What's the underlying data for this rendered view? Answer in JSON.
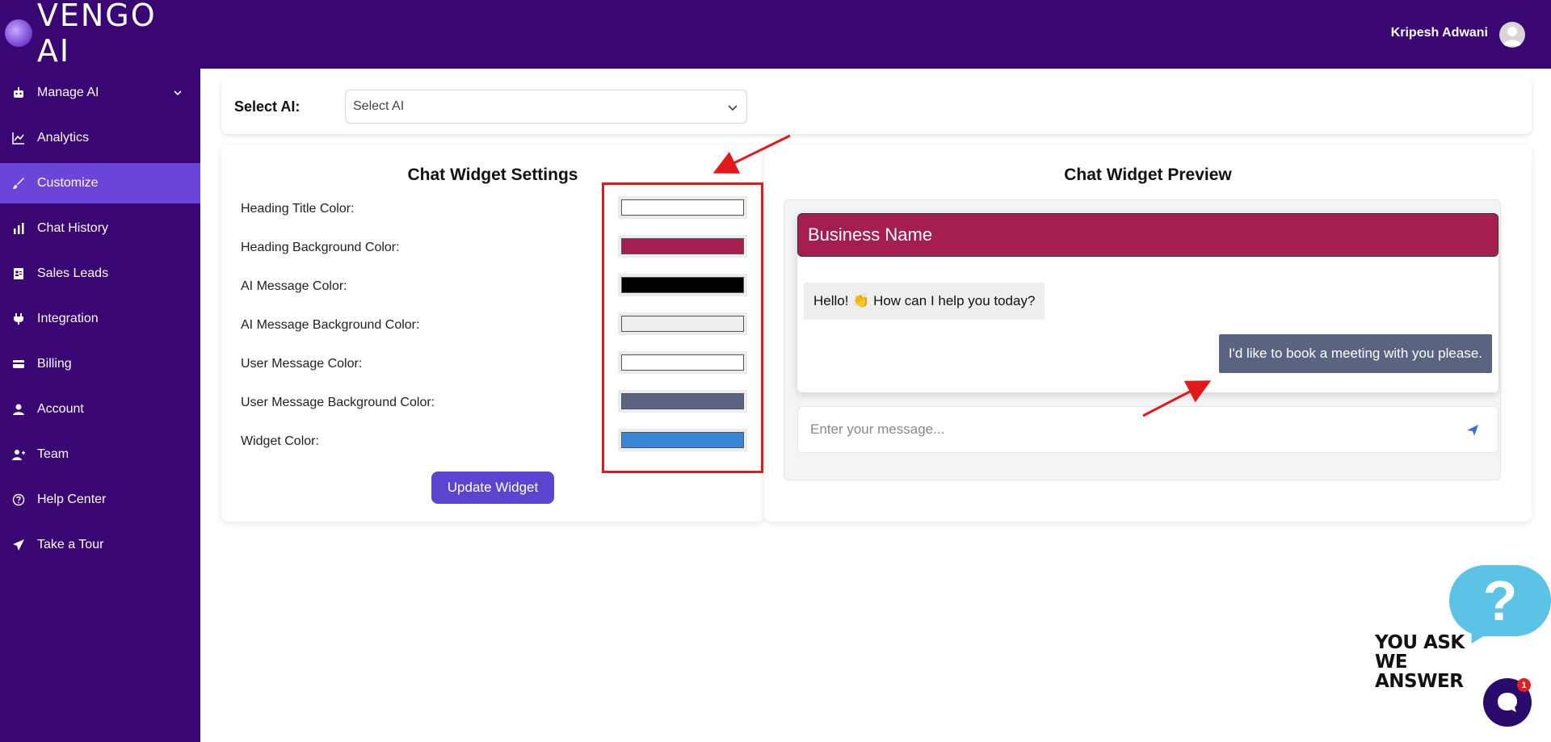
{
  "brand": {
    "name": "VENGO AI"
  },
  "user": {
    "name": "Kripesh Adwani"
  },
  "sidebar": {
    "items": [
      {
        "label": "Manage AI",
        "icon": "robot-icon",
        "active": false,
        "has_dropdown": true
      },
      {
        "label": "Analytics",
        "icon": "chart-line-icon",
        "active": false
      },
      {
        "label": "Customize",
        "icon": "brush-icon",
        "active": true
      },
      {
        "label": "Chat History",
        "icon": "bar-chart-icon",
        "active": false
      },
      {
        "label": "Sales Leads",
        "icon": "contact-card-icon",
        "active": false
      },
      {
        "label": "Integration",
        "icon": "plug-icon",
        "active": false
      },
      {
        "label": "Billing",
        "icon": "credit-card-icon",
        "active": false
      },
      {
        "label": "Account",
        "icon": "user-icon",
        "active": false
      },
      {
        "label": "Team",
        "icon": "user-plus-icon",
        "active": false
      },
      {
        "label": "Help Center",
        "icon": "question-circle-icon",
        "active": false
      },
      {
        "label": "Take a Tour",
        "icon": "paper-plane-icon",
        "active": false
      }
    ]
  },
  "select_ai": {
    "label": "Select AI:",
    "placeholder": "Select AI"
  },
  "settings": {
    "title": "Chat Widget Settings",
    "rows": [
      {
        "label": "Heading Title Color:",
        "color": "#ffffff"
      },
      {
        "label": "Heading Background Color:",
        "color": "#a51e52"
      },
      {
        "label": "AI Message Color:",
        "color": "#000000"
      },
      {
        "label": "AI Message Background Color:",
        "color": "#eeeeee"
      },
      {
        "label": "User Message Color:",
        "color": "#ffffff"
      },
      {
        "label": "User Message Background Color:",
        "color": "#5a6380"
      },
      {
        "label": "Widget Color:",
        "color": "#3a86d6"
      }
    ],
    "update_button": "Update Widget"
  },
  "preview": {
    "title": "Chat Widget Preview",
    "business_name": "Business Name",
    "ai_message": "Hello! 👏 How can I help you today?",
    "user_message": "I'd like to book a meeting with you please.",
    "input_placeholder": "Enter your message..."
  },
  "help_widget": {
    "question_mark": "?",
    "line1": "YOU ASK",
    "line2": "WE ANSWER",
    "badge_count": "1"
  },
  "colors": {
    "brand_purple": "#3a0674",
    "active_item": "#6a45d8",
    "button": "#5a45d0",
    "annotation_red": "#e01a1a"
  }
}
